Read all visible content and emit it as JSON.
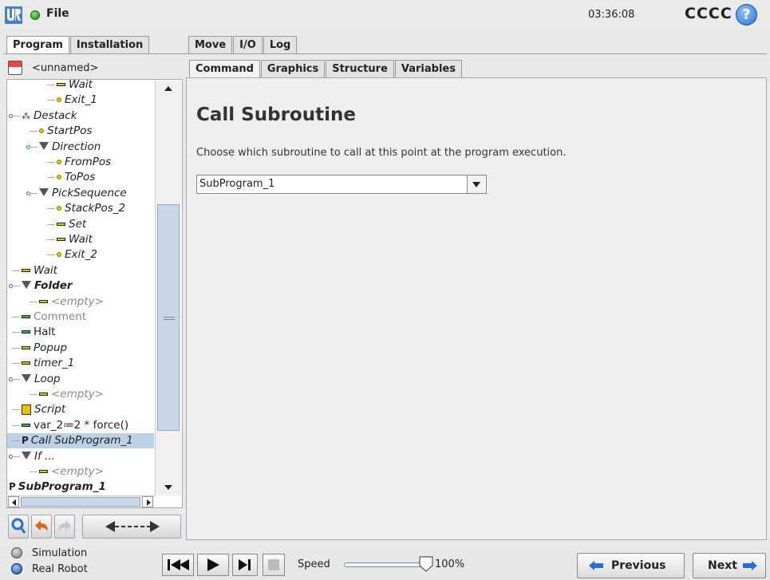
{
  "header": {
    "file_menu": "File",
    "clock": "03:36:08",
    "robot_name": "CCCC",
    "help": "?"
  },
  "main_tabs": [
    "Program",
    "Installation",
    "Move",
    "I/O",
    "Log"
  ],
  "program": {
    "name": "<unnamed>"
  },
  "sub_tabs": [
    "Command",
    "Graphics",
    "Structure",
    "Variables"
  ],
  "tree": [
    {
      "label": "Wait",
      "icon": "dash",
      "indent": 3,
      "style": "italic"
    },
    {
      "label": "Exit_1",
      "icon": "dot",
      "indent": 3,
      "style": "italic"
    },
    {
      "label": "Destack",
      "icon": "stack",
      "indent": 1,
      "style": "italic",
      "expander": true
    },
    {
      "label": "StartPos",
      "icon": "dot",
      "indent": 2,
      "style": "italic"
    },
    {
      "label": "Direction",
      "icon": "tri",
      "indent": 2,
      "style": "italic",
      "expander": true
    },
    {
      "label": "FromPos",
      "icon": "dot",
      "indent": 3,
      "style": "italic"
    },
    {
      "label": "ToPos",
      "icon": "dot",
      "indent": 3,
      "style": "italic"
    },
    {
      "label": "PickSequence",
      "icon": "tri",
      "indent": 2,
      "style": "italic",
      "expander": true
    },
    {
      "label": "StackPos_2",
      "icon": "dot",
      "indent": 3,
      "style": "italic"
    },
    {
      "label": "Set",
      "icon": "dash",
      "indent": 3,
      "style": "italic"
    },
    {
      "label": "Wait",
      "icon": "dash",
      "indent": 3,
      "style": "italic"
    },
    {
      "label": "Exit_2",
      "icon": "dot",
      "indent": 3,
      "style": "italic"
    },
    {
      "label": "Wait",
      "icon": "dash",
      "indent": 1,
      "style": "italic"
    },
    {
      "label": "Folder",
      "icon": "tri",
      "indent": 1,
      "style": "bold",
      "expander": true
    },
    {
      "label": "<empty>",
      "icon": "dash",
      "indent": 2,
      "style": "grey"
    },
    {
      "label": "Comment",
      "icon": "dash-green",
      "indent": 1,
      "style": "grey-normal"
    },
    {
      "label": "Halt",
      "icon": "dash-green",
      "indent": 1,
      "style": "normal"
    },
    {
      "label": "Popup",
      "icon": "dash",
      "indent": 1,
      "style": "italic"
    },
    {
      "label": "timer_1",
      "icon": "dash",
      "indent": 1,
      "style": "italic"
    },
    {
      "label": "Loop",
      "icon": "tri",
      "indent": 1,
      "style": "italic",
      "expander": true
    },
    {
      "label": "<empty>",
      "icon": "dash",
      "indent": 2,
      "style": "grey"
    },
    {
      "label": "Script",
      "icon": "script",
      "indent": 1,
      "style": "italic"
    },
    {
      "label": "var_2≔2 * force()",
      "icon": "dash-green",
      "indent": 1,
      "style": "normal"
    },
    {
      "label": "Call SubProgram_1",
      "icon": "call",
      "indent": 1,
      "style": "italic",
      "selected": true
    },
    {
      "label": "If ...",
      "icon": "tri",
      "indent": 1,
      "style": "italic",
      "expander": true
    },
    {
      "label": "<empty>",
      "icon": "dash",
      "indent": 2,
      "style": "grey"
    },
    {
      "label": "SubProgram_1",
      "icon": "call",
      "indent": 0,
      "style": "bold"
    }
  ],
  "content": {
    "title": "Call Subroutine",
    "description": "Choose which subroutine to call at this point at the program execution.",
    "select_value": "SubProgram_1"
  },
  "bottom": {
    "simulation": "Simulation",
    "real_robot": "Real Robot",
    "speed_label": "Speed",
    "speed_value": "100%",
    "speed_fraction": 1.0,
    "previous": "Previous",
    "next": "Next"
  },
  "colors": {
    "selected_row": "#bcd0e6",
    "status_green": "#1f8a16",
    "help_blue": "#2f6fd0",
    "icon_yellow": "#e4c400",
    "icon_green": "#3bb54a"
  }
}
